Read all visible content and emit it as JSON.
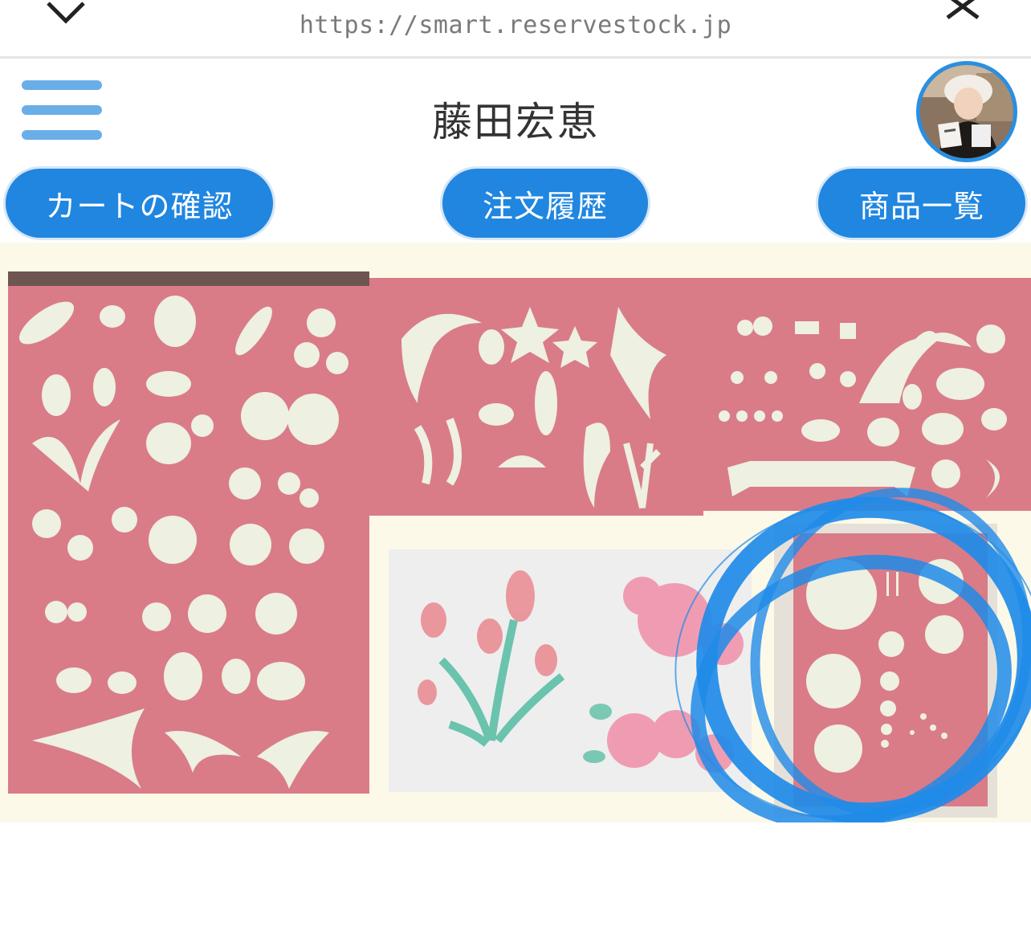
{
  "browser": {
    "url": "https://smart.reservestock.jp",
    "title_partial": "",
    "back_icon": "chevron-back-icon",
    "close_icon": "close-icon"
  },
  "header": {
    "menu_icon": "hamburger-menu-icon",
    "title": "藤田宏恵",
    "avatar": "avatar"
  },
  "nav": {
    "cart_label": "カートの確認",
    "orders_label": "注文履歴",
    "products_label": "商品一覧"
  },
  "colors": {
    "accent_blue": "#2086e0",
    "menu_blue": "#6aaee8",
    "stencil_pink": "#d87a86",
    "stencil_light": "#f1efe0",
    "image_background": "#fcf9e8",
    "annotation_blue": "#1f8be8"
  },
  "product_image": {
    "description_icon": "stencil-sheets-image",
    "annotation_icon": "hand-drawn-circle-annotation"
  }
}
